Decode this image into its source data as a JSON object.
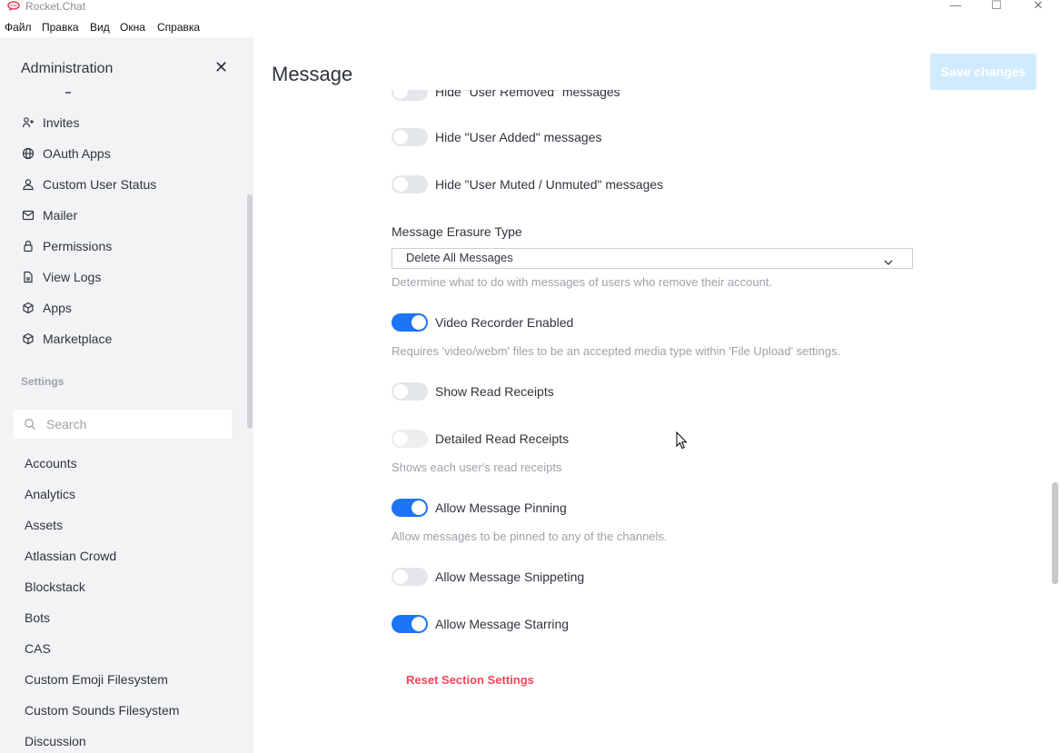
{
  "window": {
    "title": "Rocket.Chat",
    "controls": [
      "—",
      "☐",
      "✕"
    ]
  },
  "menubar": [
    "Файл",
    "Правка",
    "Вид",
    "Окна",
    "Справка"
  ],
  "sidebar": {
    "title": "Administration",
    "admin_items": [
      {
        "label": "Invites",
        "icon": "invites-icon"
      },
      {
        "label": "OAuth Apps",
        "icon": "globe-icon"
      },
      {
        "label": "Custom User Status",
        "icon": "user-icon"
      },
      {
        "label": "Mailer",
        "icon": "mail-icon"
      },
      {
        "label": "Permissions",
        "icon": "lock-icon"
      },
      {
        "label": "View Logs",
        "icon": "file-icon"
      },
      {
        "label": "Apps",
        "icon": "cube-icon"
      },
      {
        "label": "Marketplace",
        "icon": "cube-icon"
      }
    ],
    "settings_label": "Settings",
    "search_placeholder": "Search",
    "settings_groups": [
      "Accounts",
      "Analytics",
      "Assets",
      "Atlassian Crowd",
      "Blockstack",
      "Bots",
      "CAS",
      "Custom Emoji Filesystem",
      "Custom Sounds Filesystem",
      "Discussion"
    ]
  },
  "main": {
    "title": "Message",
    "save_label": "Save changes",
    "settings": {
      "hide_user_removed": {
        "label": "Hide \"User Removed\" messages",
        "enabled": false
      },
      "hide_user_added": {
        "label": "Hide \"User Added\" messages",
        "enabled": false
      },
      "hide_user_muted": {
        "label": "Hide \"User Muted / Unmuted\" messages",
        "enabled": false
      },
      "erasure": {
        "label": "Message Erasure Type",
        "value": "Delete All Messages",
        "hint": "Determine what to do with messages of users who remove their account."
      },
      "video_recorder": {
        "label": "Video Recorder Enabled",
        "enabled": true,
        "hint": "Requires 'video/webm' files to be an accepted media type within 'File Upload' settings."
      },
      "show_read_receipts": {
        "label": "Show Read Receipts",
        "enabled": false
      },
      "detailed_read_receipts": {
        "label": "Detailed Read Receipts",
        "enabled": false,
        "hint": "Shows each user's read receipts"
      },
      "allow_pinning": {
        "label": "Allow Message Pinning",
        "enabled": true,
        "hint": "Allow messages to be pinned to any of the channels."
      },
      "allow_snippeting": {
        "label": "Allow Message Snippeting",
        "enabled": false
      },
      "allow_starring": {
        "label": "Allow Message Starring",
        "enabled": true
      }
    },
    "reset_label": "Reset Section Settings"
  },
  "colors": {
    "accent": "#1d74f5",
    "danger": "#f5455c",
    "save_disabled": "#d1ebfe",
    "sidebar_bg": "#f2f3f5"
  }
}
